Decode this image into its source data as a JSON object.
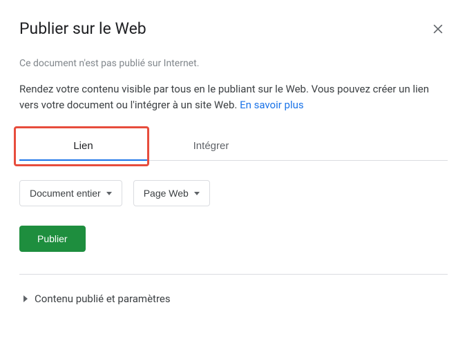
{
  "dialog": {
    "title": "Publier sur le Web",
    "status": "Ce document n'est pas publié sur Internet.",
    "description_part1": "Rendez votre contenu visible par tous en le publiant sur le Web. Vous pouvez créer un lien vers votre document ou l'intégrer à un site Web. ",
    "learn_more": "En savoir plus"
  },
  "tabs": {
    "link": "Lien",
    "embed": "Intégrer"
  },
  "dropdowns": {
    "scope": "Document entier",
    "format": "Page Web"
  },
  "actions": {
    "publish": "Publier"
  },
  "expandable": {
    "settings": "Contenu publié et paramètres"
  }
}
